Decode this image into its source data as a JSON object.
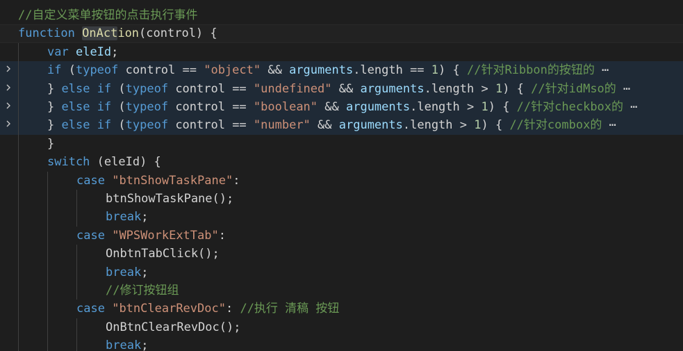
{
  "colors": {
    "background": "#1e1e1e",
    "comment": "#6a9955",
    "keyword": "#569cd6",
    "text": "#d4d4d4",
    "function": "#dcdcaa",
    "variable": "#9cdcfe",
    "string": "#ce9178",
    "number": "#b5cea8",
    "folded_region": "#1f2a36"
  },
  "icons": {
    "fold_chevron": "chevron-right-icon"
  },
  "editor": {
    "lines": [
      {
        "indent": 0,
        "folded": false,
        "tokens": [
          {
            "t": "comment",
            "v": "//自定义菜单按钮的点击执行事件"
          }
        ]
      },
      {
        "indent": 0,
        "folded": false,
        "current": true,
        "tokens": [
          {
            "t": "keyword",
            "v": "function"
          },
          {
            "t": "text",
            "v": " "
          },
          {
            "t": "highlight",
            "v": "OnAct"
          },
          {
            "t": "func",
            "v": "ion"
          },
          {
            "t": "text",
            "v": "(control) {"
          }
        ]
      },
      {
        "indent": 1,
        "folded": false,
        "tokens": [
          {
            "t": "keyword",
            "v": "var"
          },
          {
            "t": "text",
            "v": " "
          },
          {
            "t": "var",
            "v": "eleId"
          },
          {
            "t": "text",
            "v": ";"
          }
        ]
      },
      {
        "indent": 1,
        "folded": true,
        "tokens": [
          {
            "t": "keyword",
            "v": "if"
          },
          {
            "t": "text",
            "v": " ("
          },
          {
            "t": "keyword",
            "v": "typeof"
          },
          {
            "t": "text",
            "v": " control == "
          },
          {
            "t": "string",
            "v": "\"object\""
          },
          {
            "t": "text",
            "v": " && "
          },
          {
            "t": "var",
            "v": "arguments"
          },
          {
            "t": "text",
            "v": ".length == "
          },
          {
            "t": "number",
            "v": "1"
          },
          {
            "t": "text",
            "v": ") { "
          },
          {
            "t": "comment",
            "v": "//针对Ribbon的按钮的"
          },
          {
            "t": "fold",
            "v": " ⋯"
          }
        ]
      },
      {
        "indent": 1,
        "folded": true,
        "tokens": [
          {
            "t": "text",
            "v": "} "
          },
          {
            "t": "keyword",
            "v": "else"
          },
          {
            "t": "text",
            "v": " "
          },
          {
            "t": "keyword",
            "v": "if"
          },
          {
            "t": "text",
            "v": " ("
          },
          {
            "t": "keyword",
            "v": "typeof"
          },
          {
            "t": "text",
            "v": " control == "
          },
          {
            "t": "string",
            "v": "\"undefined\""
          },
          {
            "t": "text",
            "v": " && "
          },
          {
            "t": "var",
            "v": "arguments"
          },
          {
            "t": "text",
            "v": ".length > "
          },
          {
            "t": "number",
            "v": "1"
          },
          {
            "t": "text",
            "v": ") { "
          },
          {
            "t": "comment",
            "v": "//针对idMso的"
          },
          {
            "t": "fold",
            "v": " ⋯"
          }
        ]
      },
      {
        "indent": 1,
        "folded": true,
        "tokens": [
          {
            "t": "text",
            "v": "} "
          },
          {
            "t": "keyword",
            "v": "else"
          },
          {
            "t": "text",
            "v": " "
          },
          {
            "t": "keyword",
            "v": "if"
          },
          {
            "t": "text",
            "v": " ("
          },
          {
            "t": "keyword",
            "v": "typeof"
          },
          {
            "t": "text",
            "v": " control == "
          },
          {
            "t": "string",
            "v": "\"boolean\""
          },
          {
            "t": "text",
            "v": " && "
          },
          {
            "t": "var",
            "v": "arguments"
          },
          {
            "t": "text",
            "v": ".length > "
          },
          {
            "t": "number",
            "v": "1"
          },
          {
            "t": "text",
            "v": ") { "
          },
          {
            "t": "comment",
            "v": "//针对checkbox的"
          },
          {
            "t": "fold",
            "v": " ⋯"
          }
        ]
      },
      {
        "indent": 1,
        "folded": true,
        "tokens": [
          {
            "t": "text",
            "v": "} "
          },
          {
            "t": "keyword",
            "v": "else"
          },
          {
            "t": "text",
            "v": " "
          },
          {
            "t": "keyword",
            "v": "if"
          },
          {
            "t": "text",
            "v": " ("
          },
          {
            "t": "keyword",
            "v": "typeof"
          },
          {
            "t": "text",
            "v": " control == "
          },
          {
            "t": "string",
            "v": "\"number\""
          },
          {
            "t": "text",
            "v": " && "
          },
          {
            "t": "var",
            "v": "arguments"
          },
          {
            "t": "text",
            "v": ".length > "
          },
          {
            "t": "number",
            "v": "1"
          },
          {
            "t": "text",
            "v": ") { "
          },
          {
            "t": "comment",
            "v": "//针对combox的"
          },
          {
            "t": "fold",
            "v": " ⋯"
          }
        ]
      },
      {
        "indent": 1,
        "folded": false,
        "tokens": [
          {
            "t": "text",
            "v": "}"
          }
        ]
      },
      {
        "indent": 1,
        "folded": false,
        "tokens": [
          {
            "t": "keyword",
            "v": "switch"
          },
          {
            "t": "text",
            "v": " (eleId) {"
          }
        ]
      },
      {
        "indent": 2,
        "folded": false,
        "tokens": [
          {
            "t": "keyword",
            "v": "case"
          },
          {
            "t": "text",
            "v": " "
          },
          {
            "t": "string",
            "v": "\"btnShowTaskPane\""
          },
          {
            "t": "text",
            "v": ":"
          }
        ]
      },
      {
        "indent": 3,
        "folded": false,
        "tokens": [
          {
            "t": "text",
            "v": "btnShowTaskPane();"
          }
        ]
      },
      {
        "indent": 3,
        "folded": false,
        "tokens": [
          {
            "t": "keyword",
            "v": "break"
          },
          {
            "t": "text",
            "v": ";"
          }
        ]
      },
      {
        "indent": 2,
        "folded": false,
        "tokens": [
          {
            "t": "keyword",
            "v": "case"
          },
          {
            "t": "text",
            "v": " "
          },
          {
            "t": "string",
            "v": "\"WPSWorkExtTab\""
          },
          {
            "t": "text",
            "v": ":"
          }
        ]
      },
      {
        "indent": 3,
        "folded": false,
        "tokens": [
          {
            "t": "text",
            "v": "OnbtnTabClick();"
          }
        ]
      },
      {
        "indent": 3,
        "folded": false,
        "tokens": [
          {
            "t": "keyword",
            "v": "break"
          },
          {
            "t": "text",
            "v": ";"
          }
        ]
      },
      {
        "indent": 3,
        "folded": false,
        "tokens": [
          {
            "t": "comment",
            "v": "//修订按钮组"
          }
        ]
      },
      {
        "indent": 2,
        "folded": false,
        "tokens": [
          {
            "t": "keyword",
            "v": "case"
          },
          {
            "t": "text",
            "v": " "
          },
          {
            "t": "string",
            "v": "\"btnClearRevDoc\""
          },
          {
            "t": "text",
            "v": ": "
          },
          {
            "t": "comment",
            "v": "//执行 清稿 按钮"
          }
        ]
      },
      {
        "indent": 3,
        "folded": false,
        "tokens": [
          {
            "t": "text",
            "v": "OnBtnClearRevDoc();"
          }
        ]
      },
      {
        "indent": 3,
        "folded": false,
        "tokens": [
          {
            "t": "keyword",
            "v": "break"
          },
          {
            "t": "text",
            "v": ";"
          }
        ]
      }
    ]
  }
}
